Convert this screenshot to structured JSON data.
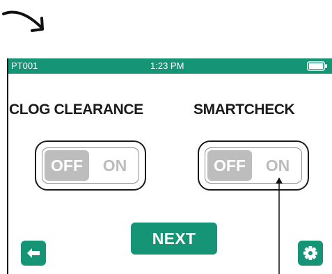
{
  "status_bar": {
    "device_id": "PT001",
    "time": "1:23 PM",
    "battery_icon": "battery-full-icon"
  },
  "clog_clearance": {
    "title": "CLOG CLEARANCE",
    "off_label": "OFF",
    "on_label": "ON",
    "state": "OFF"
  },
  "smartcheck": {
    "title": "SMARTCHECK",
    "off_label": "OFF",
    "on_label": "ON",
    "state": "OFF"
  },
  "next_button": {
    "label": "NEXT"
  },
  "back_button": {
    "icon": "arrow-left-icon"
  },
  "settings_button": {
    "icon": "gear-icon"
  },
  "colors": {
    "accent": "#169476",
    "toggle_off_fill": "#bdbdbd",
    "text": "#1a1a1a"
  }
}
